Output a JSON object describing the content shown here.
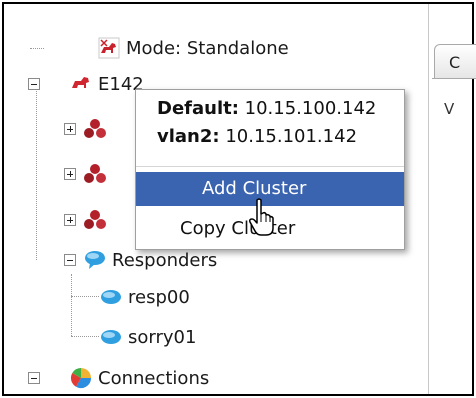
{
  "tree": {
    "items": [
      {
        "label": "Mode: Standalone",
        "icon": "dog-icon"
      },
      {
        "label": "E1",
        "suffix": "42",
        "icon": "dog-red-icon",
        "expanded": true
      },
      {
        "label": "",
        "icon": "cluster-icon",
        "expanded": false
      },
      {
        "label": "",
        "icon": "cluster-icon",
        "expanded": false
      },
      {
        "label": "",
        "icon": "cluster-icon",
        "expanded": false
      },
      {
        "label": "Responders",
        "icon": "speech-bubble-icon",
        "expanded": true
      },
      {
        "label": "resp00",
        "icon": "speech-bubble-icon"
      },
      {
        "label": "sorry01",
        "icon": "speech-bubble-icon"
      },
      {
        "label": "Connections",
        "icon": "pie-chart-icon",
        "expanded": true
      }
    ]
  },
  "popup": {
    "default_label": "Default:",
    "default_value": "10.15.100.142",
    "vlan_label": "vlan2:",
    "vlan_value": "10.15.101.142",
    "menu": [
      {
        "label": "Add Cluster",
        "highlighted": true
      },
      {
        "label": "Copy Cluster",
        "highlighted": false
      }
    ]
  },
  "right": {
    "tab_label": "C",
    "sub_label": "V"
  },
  "colors": {
    "highlight": "#3a63b0",
    "cluster_red": "#b3202a",
    "bubble_blue": "#2f9fe0"
  }
}
